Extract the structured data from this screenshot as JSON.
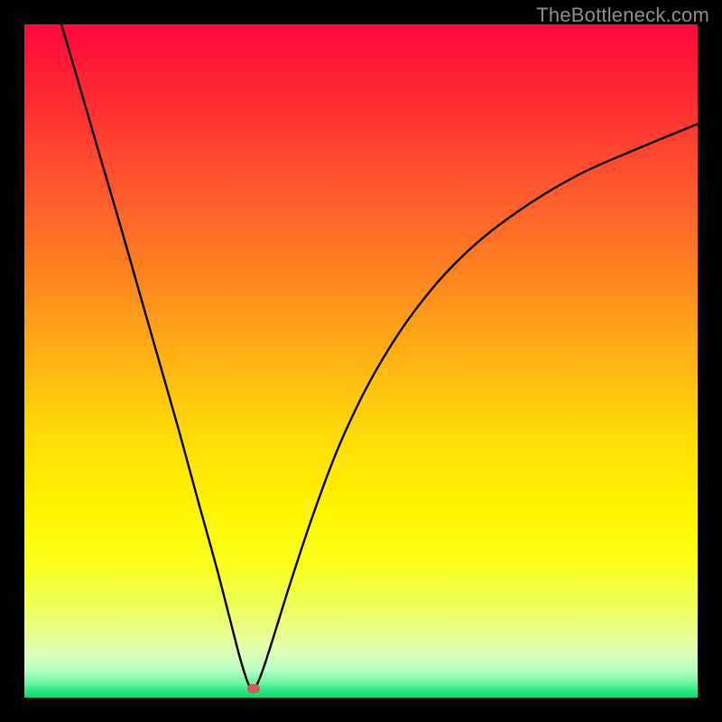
{
  "watermark": "TheBottleneck.com",
  "marker": {
    "color": "#d85a53",
    "x_frac": 0.34,
    "y_frac": 0.987
  },
  "gradient": {
    "stops": [
      {
        "offset": 0.0,
        "color": "#ff073a"
      },
      {
        "offset": 0.12,
        "color": "#ff2f33"
      },
      {
        "offset": 0.25,
        "color": "#ff5a2c"
      },
      {
        "offset": 0.38,
        "color": "#ff8720"
      },
      {
        "offset": 0.5,
        "color": "#ffb412"
      },
      {
        "offset": 0.62,
        "color": "#ffde06"
      },
      {
        "offset": 0.72,
        "color": "#fff500"
      },
      {
        "offset": 0.8,
        "color": "#fbff19"
      },
      {
        "offset": 0.86,
        "color": "#f0ff55"
      },
      {
        "offset": 0.905,
        "color": "#e8ff8e"
      },
      {
        "offset": 0.935,
        "color": "#dcffb9"
      },
      {
        "offset": 0.96,
        "color": "#b5ffc2"
      },
      {
        "offset": 0.978,
        "color": "#6cf7a0"
      },
      {
        "offset": 0.992,
        "color": "#23e37f"
      },
      {
        "offset": 1.0,
        "color": "#0fd872"
      }
    ]
  },
  "curve": {
    "stroke": "#000000",
    "width": 2.4
  },
  "chart_data": {
    "type": "line",
    "title": "",
    "xlabel": "",
    "ylabel": "",
    "xlim": [
      0,
      1
    ],
    "ylim": [
      0,
      1
    ],
    "series": [
      {
        "name": "left-branch",
        "x": [
          0.055,
          0.08,
          0.11,
          0.14,
          0.17,
          0.2,
          0.23,
          0.26,
          0.285,
          0.305,
          0.32,
          0.332,
          0.34
        ],
        "y": [
          1.0,
          0.915,
          0.812,
          0.71,
          0.605,
          0.5,
          0.395,
          0.285,
          0.195,
          0.118,
          0.06,
          0.022,
          0.008
        ]
      },
      {
        "name": "right-branch",
        "x": [
          0.34,
          0.352,
          0.37,
          0.395,
          0.43,
          0.47,
          0.52,
          0.58,
          0.65,
          0.73,
          0.82,
          0.91,
          1.0
        ],
        "y": [
          0.008,
          0.035,
          0.09,
          0.17,
          0.275,
          0.38,
          0.482,
          0.575,
          0.655,
          0.72,
          0.775,
          0.815,
          0.852
        ]
      }
    ],
    "marker_point": {
      "x": 0.34,
      "y": 0.013
    }
  }
}
